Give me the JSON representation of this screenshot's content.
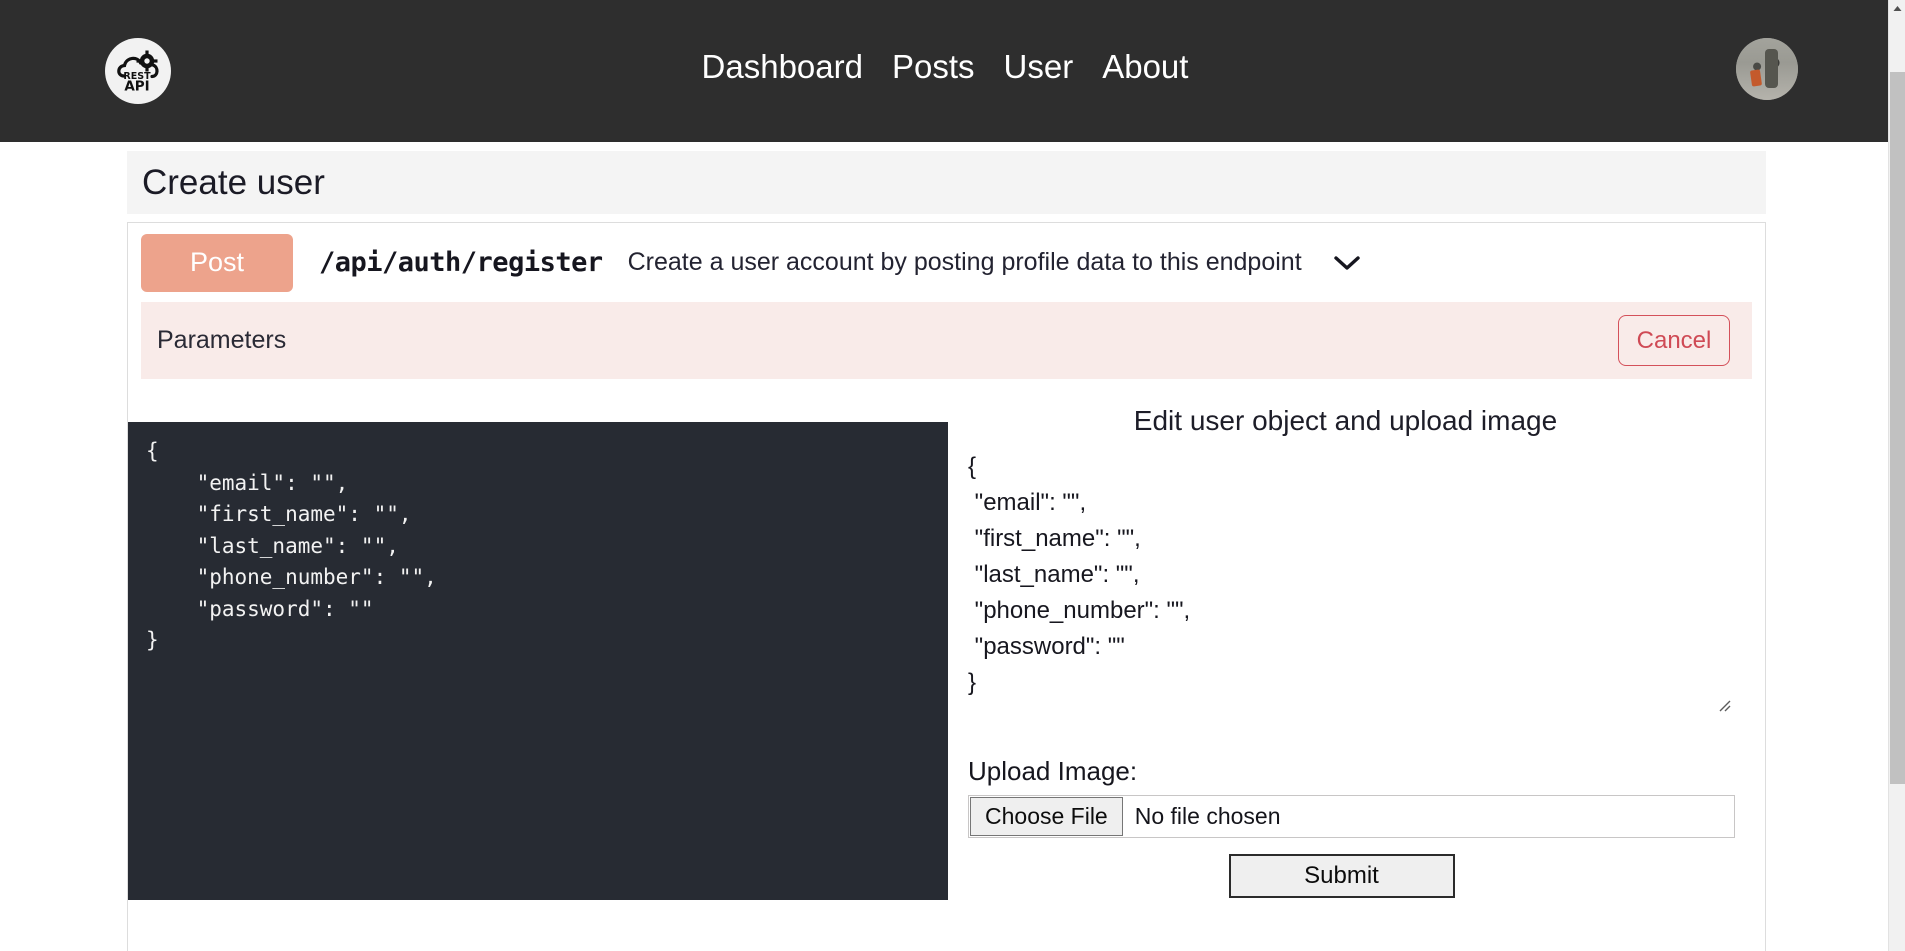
{
  "navbar": {
    "brand": {
      "icon": "rest-api-cloud-gear-logo",
      "line1": "REST",
      "line2": "API"
    },
    "links": [
      {
        "label": "Dashboard"
      },
      {
        "label": "Posts"
      },
      {
        "label": "User"
      },
      {
        "label": "About"
      }
    ],
    "avatar": {
      "icon": "user-avatar-photo",
      "alt": ""
    }
  },
  "page": {
    "title": "Create user"
  },
  "endpoint": {
    "method": "Post",
    "path": "/api/auth/register",
    "description": "Create a user account by posting profile data to this endpoint",
    "expand_icon": "chevron-down-icon"
  },
  "parameters": {
    "label": "Parameters",
    "cancel_label": "Cancel"
  },
  "code_block": {
    "content": "{\n    \"email\": \"\",\n    \"first_name\": \"\",\n    \"last_name\": \"\",\n    \"phone_number\": \"\",\n    \"password\": \"\"\n}"
  },
  "form": {
    "title": "Edit user object and upload image",
    "json_value": "{\n \"email\": \"\",\n \"first_name\": \"\",\n \"last_name\": \"\",\n \"phone_number\": \"\",\n \"password\": \"\"\n}",
    "json_placeholder": "",
    "upload_label": "Upload Image:",
    "choose_file_label": "Choose File",
    "file_status": "No file chosen",
    "submit_label": "Submit"
  },
  "colors": {
    "nav_background": "#2e2e2e",
    "method_badge": "#eda38c",
    "parameters_background": "#f9ebe9",
    "cancel_accent": "#cf4a55",
    "code_background": "#272b33",
    "header_background": "#f4f4f4"
  },
  "scrollbar": {
    "up_arrow_icon": "scroll-up-arrow-icon"
  }
}
